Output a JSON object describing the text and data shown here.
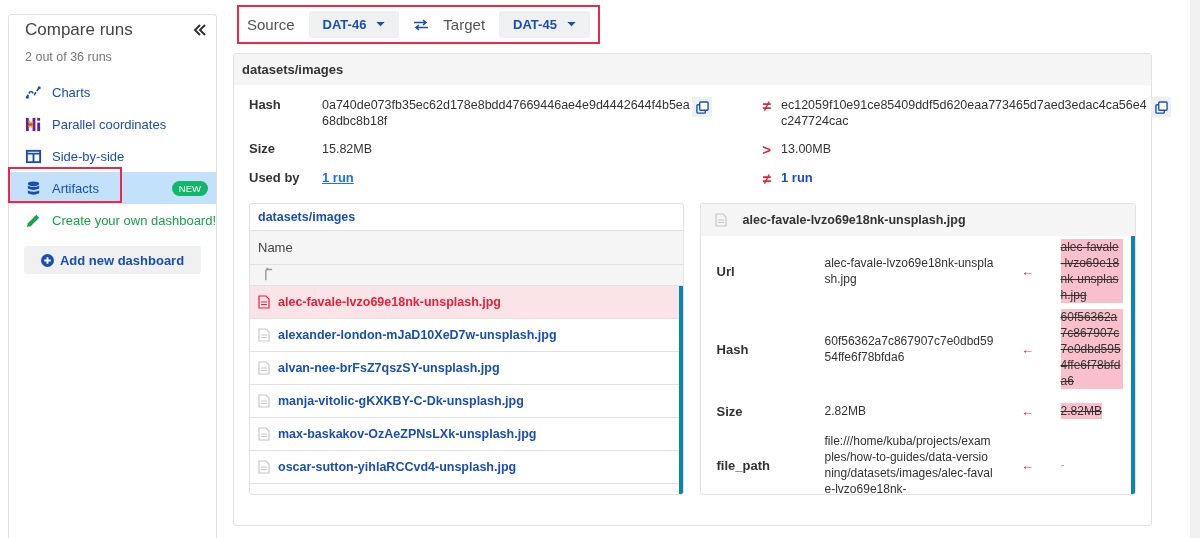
{
  "sidebar": {
    "title": "Compare runs",
    "subtitle": "2 out of 36 runs",
    "items": [
      {
        "kind": "charts",
        "label": "Charts",
        "selected": false,
        "highlighted": false
      },
      {
        "kind": "parallel",
        "label": "Parallel coordinates",
        "selected": false,
        "highlighted": false
      },
      {
        "kind": "side-by-side",
        "label": "Side-by-side",
        "selected": false,
        "highlighted": false
      },
      {
        "kind": "artifacts",
        "label": "Artifacts",
        "selected": true,
        "highlighted": true,
        "badge": "NEW"
      },
      {
        "kind": "create",
        "label": "Create your own dashboard!",
        "selected": false,
        "highlighted": false
      }
    ],
    "add_button": "Add new dashboard"
  },
  "compare_bar": {
    "highlighted": true,
    "source_label": "Source",
    "source": "DAT-46",
    "target_label": "Target",
    "target": "DAT-45"
  },
  "artifact": {
    "title": "datasets/images",
    "rows": [
      {
        "label": "Hash",
        "kind": "text",
        "source": "0a740de073fb35ec62d178e8bdd47669446ae4e9d4442644f4b5ea68dbc8b18f",
        "copyable": true,
        "symbol": "≠",
        "target": "ec12059f10e91ce85409ddf5d620eaa773465d7aed3edac4ca56e4c247724cac"
      },
      {
        "label": "Size",
        "kind": "text",
        "source": "15.82MB",
        "copyable": false,
        "symbol": ">",
        "target": "13.00MB"
      },
      {
        "label": "Used by",
        "kind": "link",
        "source": "1 run",
        "copyable": false,
        "symbol": "≠",
        "target": "1 run"
      }
    ]
  },
  "file_list": {
    "path": "datasets/images",
    "column": "Name",
    "files": [
      {
        "name": "alec-favale-lvzo69e18nk-unsplash.jpg",
        "selected": true
      },
      {
        "name": "alexander-london-mJaD10XeD7w-unsplash.jpg",
        "selected": false
      },
      {
        "name": "alvan-nee-brFsZ7qszSY-unsplash.jpg",
        "selected": false
      },
      {
        "name": "manja-vitolic-gKXKBY-C-Dk-unsplash.jpg",
        "selected": false
      },
      {
        "name": "max-baskakov-OzAeZPNsLXk-unsplash.jpg",
        "selected": false
      },
      {
        "name": "oscar-sutton-yihlaRCCvd4-unsplash.jpg",
        "selected": false
      }
    ]
  },
  "file_detail": {
    "title": "alec-favale-lvzo69e18nk-unsplash.jpg",
    "rows": [
      {
        "label": "Url",
        "source": "alec-favale-lvzo69e18nk-unsplash.jpg",
        "symbol": "←",
        "target": "alec-favale-lvzo69e18nk-unsplash.jpg",
        "removed": true
      },
      {
        "label": "Hash",
        "source": "60f56362a7c867907c7e0dbd5954ffe6f78bfda6",
        "symbol": "←",
        "target": "60f56362a7c867907c7e0dbd5954ffe6f78bfda6",
        "removed": true
      },
      {
        "label": "Size",
        "source": "2.82MB",
        "symbol": "←",
        "target": "2.82MB",
        "removed": true
      },
      {
        "label": "file_path",
        "source": "file:///home/kuba/projects/examples/how-to-guides/data-versioning/datasets/images/alec-favale-lvzo69e18nk-",
        "symbol": "←",
        "target": "-",
        "removed": false
      }
    ]
  }
}
